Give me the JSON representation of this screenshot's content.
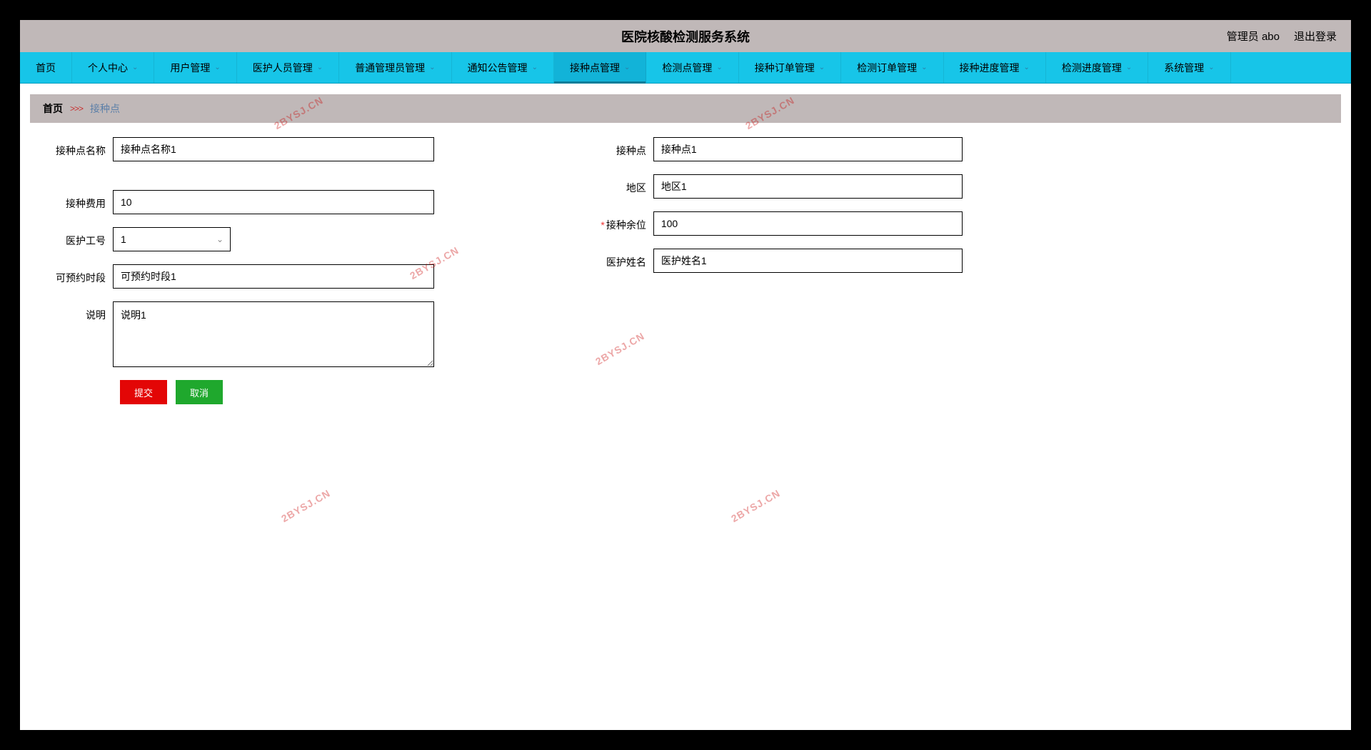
{
  "header": {
    "title": "医院核酸检测服务系统",
    "user_label": "管理员 abo",
    "logout_label": "退出登录"
  },
  "nav": {
    "items": [
      {
        "label": "首页",
        "dropdown": false
      },
      {
        "label": "个人中心",
        "dropdown": true
      },
      {
        "label": "用户管理",
        "dropdown": true
      },
      {
        "label": "医护人员管理",
        "dropdown": true
      },
      {
        "label": "普通管理员管理",
        "dropdown": true
      },
      {
        "label": "通知公告管理",
        "dropdown": true
      },
      {
        "label": "接种点管理",
        "dropdown": true,
        "active": true
      },
      {
        "label": "检测点管理",
        "dropdown": true
      },
      {
        "label": "接种订单管理",
        "dropdown": true
      },
      {
        "label": "检测订单管理",
        "dropdown": true
      },
      {
        "label": "接种进度管理",
        "dropdown": true
      },
      {
        "label": "检测进度管理",
        "dropdown": true
      },
      {
        "label": "系统管理",
        "dropdown": true
      }
    ]
  },
  "breadcrumb": {
    "home": "首页",
    "current": "接种点"
  },
  "form": {
    "site_name": {
      "label": "接种点名称",
      "value": "接种点名称1"
    },
    "site": {
      "label": "接种点",
      "value": "接种点1"
    },
    "region": {
      "label": "地区",
      "value": "地区1"
    },
    "cost": {
      "label": "接种费用",
      "value": "10"
    },
    "remaining": {
      "label": "接种余位",
      "value": "100",
      "required": true
    },
    "staff_id": {
      "label": "医护工号",
      "value": "1"
    },
    "staff_name": {
      "label": "医护姓名",
      "value": "医护姓名1"
    },
    "timeslot": {
      "label": "可预约时段",
      "value": "可预约时段1"
    },
    "description": {
      "label": "说明",
      "value": "说明1"
    }
  },
  "buttons": {
    "submit": "提交",
    "cancel": "取消"
  },
  "watermark": "2BYSJ.CN"
}
